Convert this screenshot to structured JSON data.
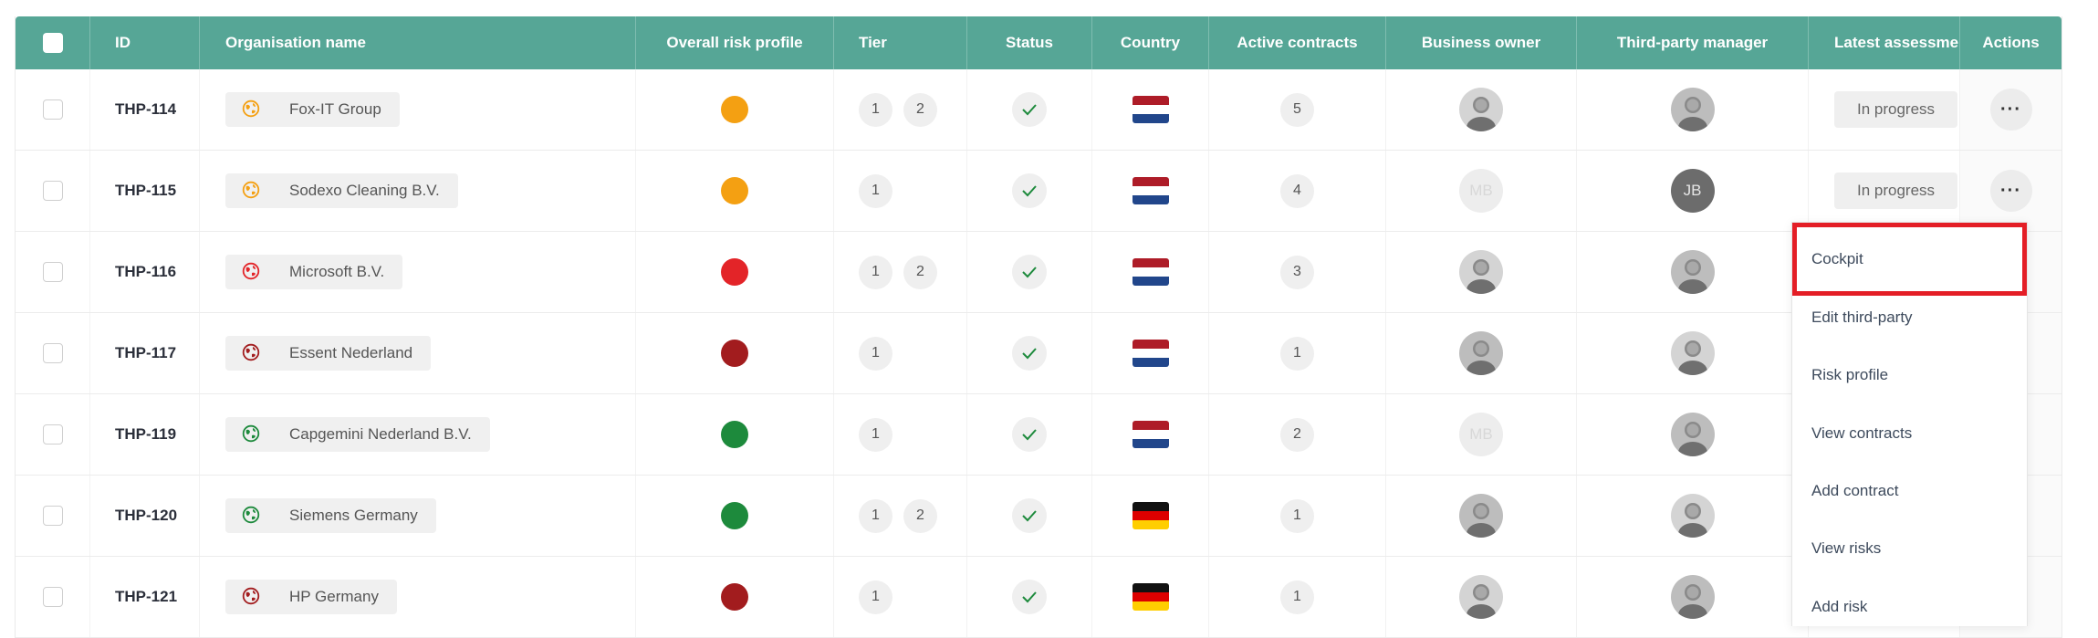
{
  "columns": {
    "id": "ID",
    "org": "Organisation name",
    "risk": "Overall risk profile",
    "tier": "Tier",
    "status": "Status",
    "country": "Country",
    "contracts": "Active contracts",
    "owner": "Business owner",
    "tpm": "Third-party manager",
    "latest": "Latest assessment",
    "actions": "Actions"
  },
  "colors": {
    "header_bg": "#56a696",
    "risk_orange": "#f4a012",
    "risk_red": "#e32428",
    "risk_darkred": "#a21c1e",
    "risk_green": "#1d8a3c",
    "status_check": "#1d8a3c",
    "menu_highlight": "#e41e26"
  },
  "rows": [
    {
      "id": "THP-114",
      "org": "Fox-IT Group",
      "org_icon_color": "#f4a012",
      "risk": "orange",
      "tiers": [
        "1",
        "2"
      ],
      "status": "check-icon",
      "country_flag": "netherlands",
      "contracts": "5",
      "owner": {
        "type": "photo"
      },
      "tpm": {
        "type": "photo"
      },
      "latest": "In progress",
      "actions": "···"
    },
    {
      "id": "THP-115",
      "org": "Sodexo Cleaning B.V.",
      "org_icon_color": "#f4a012",
      "risk": "orange",
      "tiers": [
        "1"
      ],
      "status": "check-icon",
      "country_flag": "netherlands",
      "contracts": "4",
      "owner": {
        "type": "initials-light",
        "initials": "MB"
      },
      "tpm": {
        "type": "initials-dark",
        "initials": "JB"
      },
      "latest": "In progress",
      "actions": "···"
    },
    {
      "id": "THP-116",
      "org": "Microsoft B.V.",
      "org_icon_color": "#e32428",
      "risk": "red",
      "tiers": [
        "1",
        "2"
      ],
      "status": "check-icon",
      "country_flag": "netherlands",
      "contracts": "3",
      "owner": {
        "type": "photo"
      },
      "tpm": {
        "type": "photo"
      },
      "latest": "",
      "actions": ""
    },
    {
      "id": "THP-117",
      "org": "Essent Nederland",
      "org_icon_color": "#a21c1e",
      "risk": "darkred",
      "tiers": [
        "1"
      ],
      "status": "check-icon",
      "country_flag": "netherlands",
      "contracts": "1",
      "owner": {
        "type": "photo"
      },
      "tpm": {
        "type": "photo"
      },
      "latest": "",
      "actions": ""
    },
    {
      "id": "THP-119",
      "org": "Capgemini Nederland B.V.",
      "org_icon_color": "#1d8a3c",
      "risk": "green",
      "tiers": [
        "1"
      ],
      "status": "check-icon",
      "country_flag": "netherlands",
      "contracts": "2",
      "owner": {
        "type": "initials-light",
        "initials": "MB"
      },
      "tpm": {
        "type": "photo"
      },
      "latest": "",
      "actions": ""
    },
    {
      "id": "THP-120",
      "org": "Siemens Germany",
      "org_icon_color": "#1d8a3c",
      "risk": "green",
      "tiers": [
        "1",
        "2"
      ],
      "status": "check-icon",
      "country_flag": "germany",
      "contracts": "1",
      "owner": {
        "type": "photo"
      },
      "tpm": {
        "type": "photo"
      },
      "latest": "",
      "actions": ""
    },
    {
      "id": "THP-121",
      "org": "HP Germany",
      "org_icon_color": "#a21c1e",
      "risk": "darkred",
      "tiers": [
        "1"
      ],
      "status": "check-icon",
      "country_flag": "germany",
      "contracts": "1",
      "owner": {
        "type": "photo"
      },
      "tpm": {
        "type": "photo"
      },
      "latest": "",
      "actions": ""
    }
  ],
  "menu": {
    "items": [
      "Cockpit",
      "Edit third-party",
      "Risk profile",
      "View contracts",
      "Add contract",
      "View risks",
      "Add risk"
    ],
    "highlighted": "Cockpit"
  }
}
